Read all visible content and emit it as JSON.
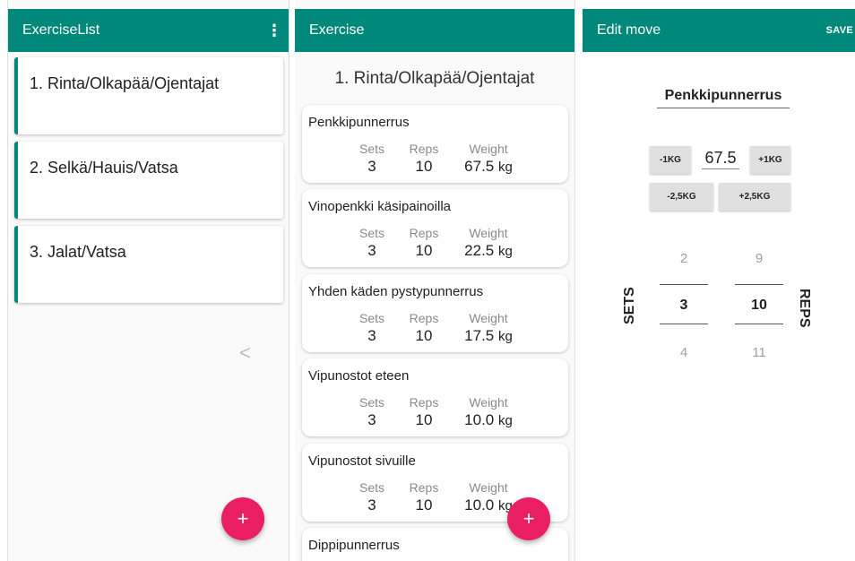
{
  "workout_list": {
    "title": "ExerciseList",
    "workouts": [
      "1. Rinta/Olkapää/Ojentajat",
      "2. Selkä/Hauis/Vatsa",
      "3. Jalat/Vatsa"
    ],
    "back_glyph": "<",
    "fab_label": "+"
  },
  "exercise": {
    "title": "Exercise",
    "workout_title": "1. Rinta/Olkapää/Ojentajat",
    "labels": {
      "sets": "Sets",
      "reps": "Reps",
      "weight": "Weight"
    },
    "unit": "kg",
    "items": [
      {
        "name": "Penkkipunnerrus",
        "sets": "3",
        "reps": "10",
        "weight": "67.5"
      },
      {
        "name": "Vinopenkki käsipainoilla",
        "sets": "3",
        "reps": "10",
        "weight": "22.5"
      },
      {
        "name": "Yhden käden pystypunnerrus",
        "sets": "3",
        "reps": "10",
        "weight": "17.5"
      },
      {
        "name": "Vipunostot eteen",
        "sets": "3",
        "reps": "10",
        "weight": "10.0"
      },
      {
        "name": "Vipunostot sivuille",
        "sets": "3",
        "reps": "10",
        "weight": "10.0"
      },
      {
        "name": "Dippipunnerrus"
      }
    ],
    "fab_label": "+"
  },
  "edit_move": {
    "title": "Edit move",
    "save_label": "SAVE",
    "move_name": "Penkkipunnerrus",
    "weight": "67.5",
    "buttons": {
      "minus1": "-1KG",
      "plus1": "+1KG",
      "minus25": "-2,5KG",
      "plus25": "+2,5KG"
    },
    "sets_picker": {
      "label": "SETS",
      "prev": "2",
      "current": "3",
      "next": "4"
    },
    "reps_picker": {
      "label": "REPS",
      "prev": "9",
      "current": "10",
      "next": "11"
    }
  }
}
